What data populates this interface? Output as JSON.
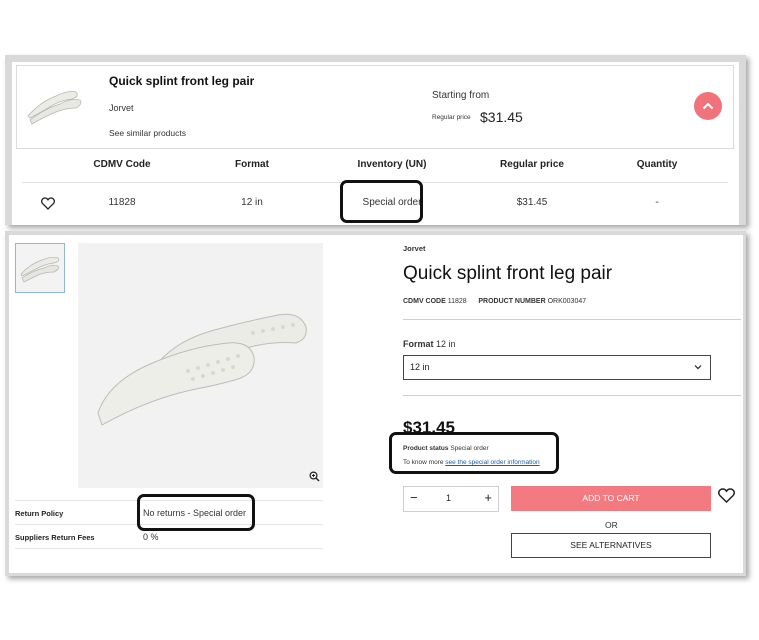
{
  "top_card": {
    "title": "Quick splint front leg pair",
    "brand": "Jorvet",
    "similar_link": "See similar products",
    "starting_from": "Starting from",
    "regular_price_label": "Regular price",
    "regular_price_value": "$31.45"
  },
  "table": {
    "headers": [
      "CDMV Code",
      "Format",
      "Inventory (UN)",
      "Regular price",
      "Quantity"
    ],
    "row": {
      "code": "11828",
      "format": "12 in",
      "inventory": "Special order",
      "price": "$31.45",
      "quantity": "-"
    }
  },
  "product": {
    "brand": "Jorvet",
    "title": "Quick splint front leg pair",
    "code_label": "CDMV CODE",
    "code_value": "11828",
    "number_label": "PRODUCT NUMBER",
    "number_value": "ORK003047",
    "format_label": "Format",
    "format_value": "12 in",
    "select_value": "12 in",
    "price": "$31.45",
    "status_label": "Product status",
    "status_value": "Special order",
    "know_more": "To know more",
    "know_more_link": "see the special order information",
    "quantity": "1",
    "add_to_cart": "ADD TO CART",
    "or": "OR",
    "see_alternatives": "SEE ALTERNATIVES"
  },
  "policies": [
    {
      "label": "Return Policy",
      "value": "No returns - Special order"
    },
    {
      "label": "Suppliers Return Fees",
      "value": "0 %"
    }
  ],
  "colors": {
    "accent": "#f47a82",
    "collapse_button": "#f0737b",
    "link": "#1a5ba8"
  },
  "icons": [
    "chevron-up-icon",
    "heart-icon",
    "zoom-in-icon",
    "chevron-down-icon"
  ]
}
